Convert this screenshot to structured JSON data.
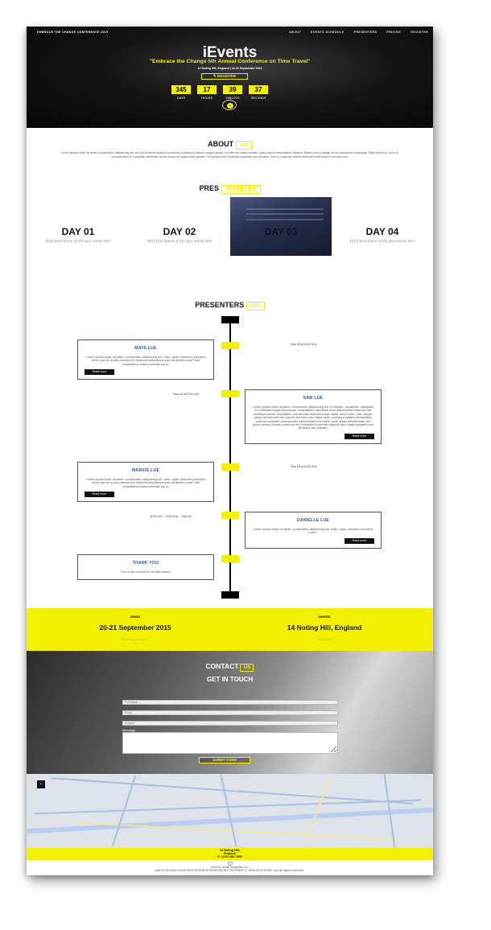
{
  "nav": {
    "brand": "EMBRACE THE CHANGE CONFERENCE 2015",
    "links": [
      "ABOUT",
      "EVENTS SCHEDULE",
      "PRESENTERS",
      "PRICING",
      "REGISTER"
    ]
  },
  "hero": {
    "title": "iEvents",
    "tagline": "\"Embrace the Change 5th Annual Conference on Time Travel\"",
    "subtitle": "14 Noting Hill, England | 20-21 September 2015",
    "register": "REGISTER",
    "countdown": [
      {
        "value": "345",
        "label": "DAYS"
      },
      {
        "value": "17",
        "label": "HOURS"
      },
      {
        "value": "39",
        "label": "MINUTES"
      },
      {
        "value": "37",
        "label": "SECONDS"
      }
    ]
  },
  "about": {
    "title": "ABOUT",
    "title_boxed": "US",
    "text": "Lorem ipsum dolor sit amet, consectetur adipisicing elit, sed do eiusmod tempor incididunt ut labore et dolore magna aliqua. Ut enim ad minim veniam, quis nostrud exercitation ullamco laboris nisi ut aliquip ex ea commodo consequat. Duis aute irure dolor in reprehenderit in voluptate velit esse cillum dolore eu fugiat nulla pariatur. Excepteur sint occaecat cupidatat non proident, sunt in culpa qui officia deserunt mollit anim id est laborum."
  },
  "schedule": {
    "title": "PRES",
    "title_boxed": "SCHEDULE",
    "days": [
      {
        "title": "DAY 01",
        "desc": "Brief description of the days events here"
      },
      {
        "title": "DAY 02",
        "desc": "Brief description of the days events here"
      },
      {
        "title": "DAY 03",
        "desc": ""
      },
      {
        "title": "DAY 04",
        "desc": "Brief description of the days events here"
      }
    ]
  },
  "presenters": {
    "title": "PRESENTERS",
    "title_boxed": "BIO",
    "items": [
      {
        "name": "MAYA LUE",
        "text": "Lorem ipsum dolor sit amet, consectetur adipisicing elit. Iusto, optio, dolorum provident rerum aut hic quasi placeat iure tempora laudantium ipsa ad debitis unde? Iste voluptatibus minus veritatis qui ut.",
        "button": "Read more",
        "date": "Sep 18 at 8:30 a.m."
      },
      {
        "name": "SAM LUE",
        "text": "Lorem ipsum dolor sit amet, consectetur adipisicing elit. Excepturi, obcaecati, quisquam id molestias eaque asperiores voluptatibus cupiditate error assumenda delectus odit similique earum voluptatem doloremque dolorem ipsam quae rerum quis. Odit, itaque, deserunt corporis vero ipsum nisi eius odio natus ullam provident pariatur temporibus quia eos repellat consequuntur perferendis enim amet quae quasi repudiandae sed quod veniam dolore possimus rem voluptatum eveniet eligendi quis fugiat aliquam sunt similique aut adipisci.",
        "button": "Read more",
        "date": "Sep 18 at 8:30 a.m."
      },
      {
        "name": "MARKIE LUE",
        "text": "Lorem ipsum dolor sit amet, consectetur adipisicing elit. Iusto, optio, dolorum provident rerum aut hic quasi placeat iure tempora laudantium ipsa ad debitis unde? Iste voluptatibus minus veritatis qui ut.",
        "button": "Read more",
        "date": "Sep 18 at 8:30 a.m."
      },
      {
        "name": "DANIELLE LUE",
        "text": "Lorem ipsum dolor sit amet, consectetur adipisicing elit. Iusto, optio, dolorum provident rerum.",
        "button": "Read more",
        "date": "8:30 a.m. - 9:45 a.m. - Sep 18"
      },
      {
        "name": "THANK YOU",
        "text": "This is the content of the last section",
        "button": "",
        "date": ""
      }
    ]
  },
  "info": {
    "when_label": "WHEN",
    "when_value": "20-21 September 2015",
    "when_sub": "Starting at 10 a.m.",
    "where_label": "WHERE",
    "where_value": "14 Noting Hill, England",
    "where_sub": "Directions"
  },
  "contact": {
    "title": "CONTACT",
    "title_boxed": "US",
    "get_in_touch": "GET IN TOUCH",
    "fields": [
      "Full Name",
      "Email",
      "Subject"
    ],
    "message_label": "Message",
    "submit": "SUBMIT FORM"
  },
  "address": {
    "line1": "14 Noting Hill,",
    "line2": "England",
    "line3": "P: (123) 456-7890"
  },
  "footer": {
    "up": "⌃",
    "copyright": "©2014 Landit Template LLC",
    "links": "ABOUTSCHEDULE/EVENTSPRESENTERSCONTACTSITEMAP © 1998-2013 ZURB, Inc. All rights reserved."
  },
  "colors": {
    "accent": "#f3f000",
    "hero_bg": "#111111",
    "link_blue": "#2a5298"
  }
}
